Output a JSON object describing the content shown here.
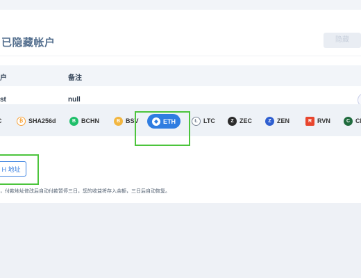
{
  "panel": {
    "title": "已隐藏帐户",
    "top_button": "隐藏"
  },
  "table": {
    "headers": [
      "户",
      "备注"
    ],
    "row": {
      "account": "st",
      "remark": "null"
    }
  },
  "coins": [
    {
      "label": "C",
      "icon": "partial-coin-icon",
      "color": "#333333"
    },
    {
      "label": "SHA256d",
      "icon": "sha256d-icon",
      "color": "#f7a33a"
    },
    {
      "label": "BCHN",
      "icon": "bchn-icon",
      "color": "#1fbf6a"
    },
    {
      "label": "BSV",
      "icon": "bsv-icon",
      "color": "#f2b640"
    },
    {
      "label": "LTC",
      "icon": "ltc-icon",
      "color": "#7c8798"
    },
    {
      "label": "ZEC",
      "icon": "zec-icon",
      "color": "#2b2b2b"
    },
    {
      "label": "ZEN",
      "icon": "zen-icon",
      "color": "#2f5fd0"
    },
    {
      "label": "RVN",
      "icon": "rvn-icon",
      "color": "#e8462e"
    },
    {
      "label": "CK",
      "icon": "ckb-icon",
      "color": "#1f6b3d"
    }
  ],
  "active_coin": {
    "label": "ETH",
    "icon": "eth-icon",
    "color": "#2f7de1"
  },
  "address_button": "H 地址",
  "note": "，付款地址修改后自动付款暂停三日，您的收益将存入余额，三日后自动恢复。",
  "colors": {
    "highlight": "#4cc43c",
    "accent": "#2f7de1"
  }
}
